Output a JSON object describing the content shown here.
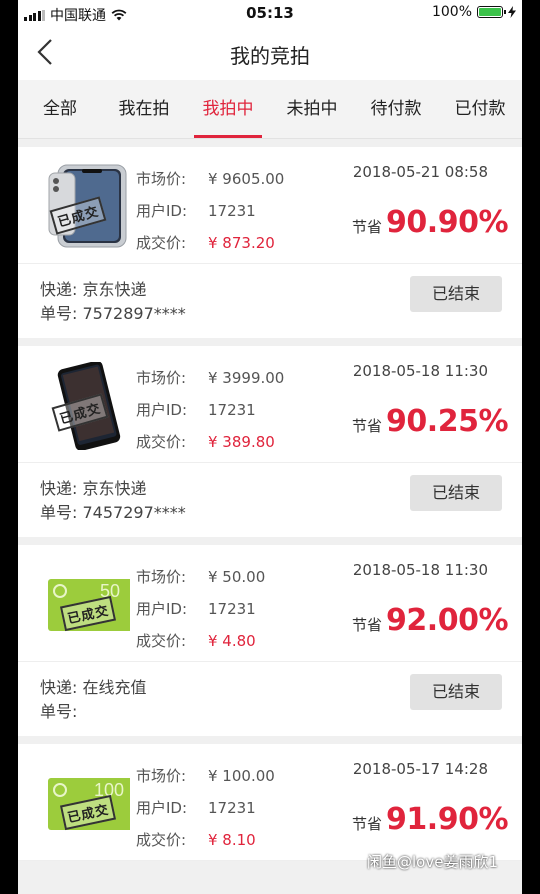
{
  "status": {
    "carrier": "中国联通",
    "time": "05:13",
    "battery": "100%"
  },
  "nav": {
    "title": "我的竞拍"
  },
  "tabs": [
    {
      "label": "全部"
    },
    {
      "label": "我在拍"
    },
    {
      "label": "我拍中",
      "active": true
    },
    {
      "label": "未拍中"
    },
    {
      "label": "待付款"
    },
    {
      "label": "已付款"
    }
  ],
  "labels": {
    "market": "市场价:",
    "userid": "用户ID:",
    "deal": "成交价:",
    "save": "节省",
    "express": "快递:",
    "order": "单号:",
    "ended": "已结束",
    "stamp": "已成交"
  },
  "items": [
    {
      "market": "¥ 9605.00",
      "userid": "17231",
      "deal": "¥ 873.20",
      "date": "2018-05-21 08:58",
      "save_pct": "90.90%",
      "express": "京东快递",
      "order": "7572897****",
      "thumb": "phone-silver"
    },
    {
      "market": "¥ 3999.00",
      "userid": "17231",
      "deal": "¥ 389.80",
      "date": "2018-05-18 11:30",
      "save_pct": "90.25%",
      "express": "京东快递",
      "order": "7457297****",
      "thumb": "phone-black"
    },
    {
      "market": "¥ 50.00",
      "userid": "17231",
      "deal": "¥ 4.80",
      "date": "2018-05-18 11:30",
      "save_pct": "92.00%",
      "express": "在线充值",
      "order": "",
      "thumb": "card-green",
      "card_text": "50"
    },
    {
      "market": "¥ 100.00",
      "userid": "17231",
      "deal": "¥ 8.10",
      "date": "2018-05-17 14:28",
      "save_pct": "91.90%",
      "thumb": "card-green",
      "card_text": "100"
    }
  ],
  "watermark": "闲鱼@love姜雨欣1",
  "colors": {
    "accent": "#e0243c",
    "battery": "#3bc24a"
  }
}
